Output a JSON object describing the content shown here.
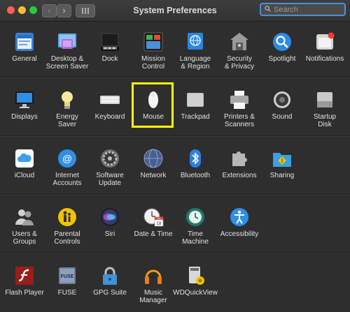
{
  "window": {
    "title": "System Preferences"
  },
  "search": {
    "placeholder": "Search"
  },
  "sections": [
    {
      "items": [
        {
          "label": "General",
          "icon": "general-icon"
        },
        {
          "label": "Desktop &\nScreen Saver",
          "icon": "desktop-screensaver-icon"
        },
        {
          "label": "Dock",
          "icon": "dock-icon"
        },
        {
          "label": "Mission\nControl",
          "icon": "mission-control-icon"
        },
        {
          "label": "Language\n& Region",
          "icon": "language-region-icon"
        },
        {
          "label": "Security\n& Privacy",
          "icon": "security-privacy-icon"
        },
        {
          "label": "Spotlight",
          "icon": "spotlight-icon"
        },
        {
          "label": "Notifications",
          "icon": "notifications-icon"
        }
      ]
    },
    {
      "items": [
        {
          "label": "Displays",
          "icon": "displays-icon"
        },
        {
          "label": "Energy\nSaver",
          "icon": "energy-saver-icon"
        },
        {
          "label": "Keyboard",
          "icon": "keyboard-icon"
        },
        {
          "label": "Mouse",
          "icon": "mouse-icon"
        },
        {
          "label": "Trackpad",
          "icon": "trackpad-icon"
        },
        {
          "label": "Printers &\nScanners",
          "icon": "printers-scanners-icon"
        },
        {
          "label": "Sound",
          "icon": "sound-icon"
        },
        {
          "label": "Startup\nDisk",
          "icon": "startup-disk-icon"
        }
      ]
    },
    {
      "items": [
        {
          "label": "iCloud",
          "icon": "icloud-icon"
        },
        {
          "label": "Internet\nAccounts",
          "icon": "internet-accounts-icon"
        },
        {
          "label": "Software\nUpdate",
          "icon": "software-update-icon"
        },
        {
          "label": "Network",
          "icon": "network-icon"
        },
        {
          "label": "Bluetooth",
          "icon": "bluetooth-icon"
        },
        {
          "label": "Extensions",
          "icon": "extensions-icon"
        },
        {
          "label": "Sharing",
          "icon": "sharing-icon"
        }
      ]
    },
    {
      "items": [
        {
          "label": "Users &\nGroups",
          "icon": "users-groups-icon"
        },
        {
          "label": "Parental\nControls",
          "icon": "parental-controls-icon"
        },
        {
          "label": "Siri",
          "icon": "siri-icon"
        },
        {
          "label": "Date & Time",
          "icon": "date-time-icon"
        },
        {
          "label": "Time\nMachine",
          "icon": "time-machine-icon"
        },
        {
          "label": "Accessibility",
          "icon": "accessibility-icon"
        }
      ]
    },
    {
      "items": [
        {
          "label": "Flash Player",
          "icon": "flash-player-icon"
        },
        {
          "label": "FUSE",
          "icon": "fuse-icon"
        },
        {
          "label": "GPG Suite",
          "icon": "gpg-suite-icon"
        },
        {
          "label": "Music\nManager",
          "icon": "music-manager-icon"
        },
        {
          "label": "WDQuickView",
          "icon": "wdquickview-icon"
        }
      ]
    }
  ],
  "icon_texts": {
    "general": "File New One",
    "date_time_month": "JUL",
    "date_time_day": "18",
    "fuse": "FUSE"
  },
  "highlighted": "Mouse"
}
